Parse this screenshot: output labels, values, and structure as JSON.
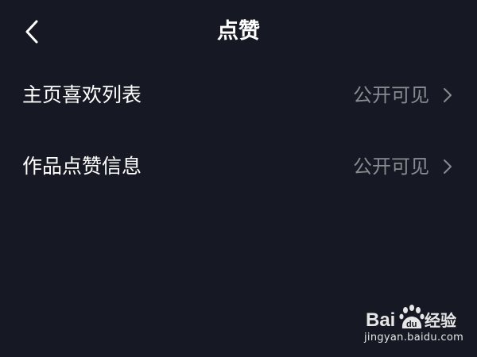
{
  "header": {
    "title": "点赞",
    "back_icon": "chevron-left-icon"
  },
  "settings": [
    {
      "label": "主页喜欢列表",
      "value": "公开可见",
      "icon": "chevron-right-icon"
    },
    {
      "label": "作品点赞信息",
      "value": "公开可见",
      "icon": "chevron-right-icon"
    }
  ],
  "watermark": {
    "logo_text": "Baidu经验",
    "url": "jingyan.baidu.com"
  },
  "colors": {
    "background": "#161823",
    "text_primary": "#ffffff",
    "text_secondary": "#8a8b91"
  }
}
